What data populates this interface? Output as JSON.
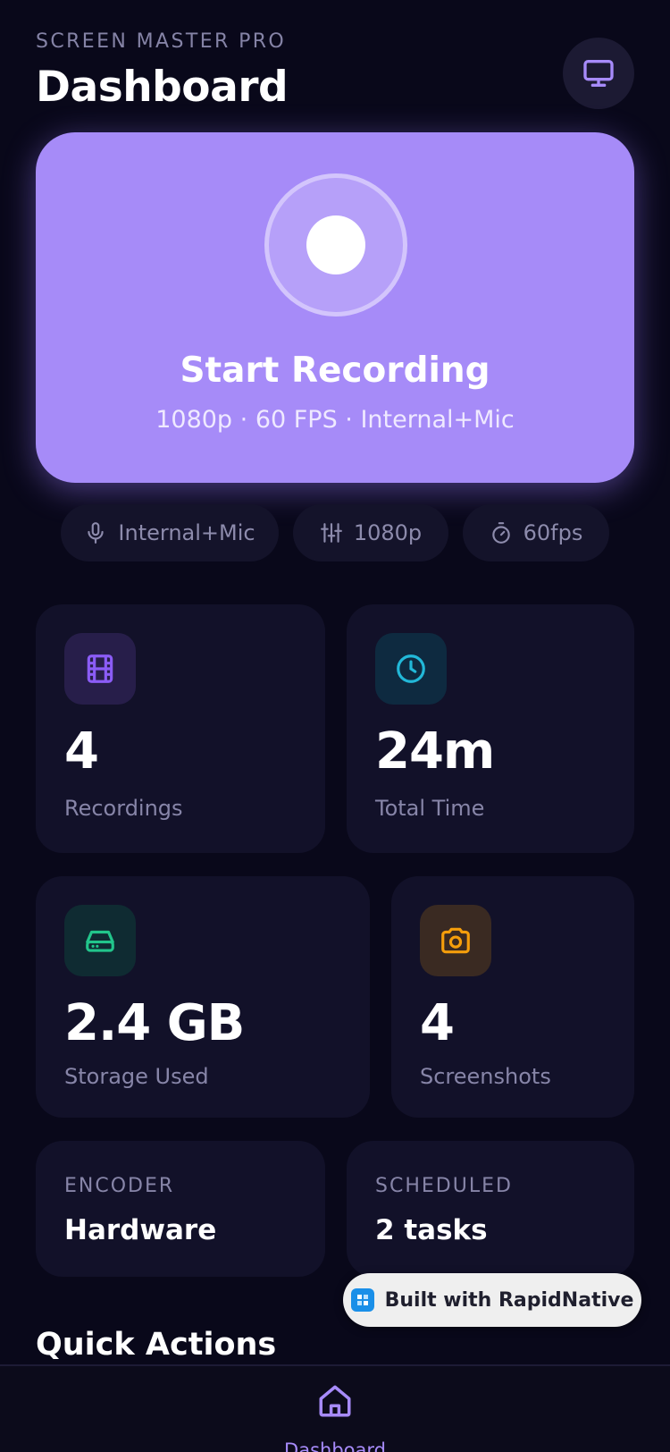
{
  "header": {
    "app_label": "SCREEN MASTER PRO",
    "title": "Dashboard",
    "monitor_icon": "monitor-icon"
  },
  "hero": {
    "title": "Start Recording",
    "subtitle": "1080p · 60 FPS · Internal+Mic",
    "color": "#a68bf8"
  },
  "chips": [
    {
      "icon": "microphone-icon",
      "label": "Internal+Mic"
    },
    {
      "icon": "sliders-icon",
      "label": "1080p"
    },
    {
      "icon": "stopwatch-icon",
      "label": "60fps"
    }
  ],
  "stats": [
    {
      "icon": "film-icon",
      "value": "4",
      "label": "Recordings",
      "accent": "#8b5cf6"
    },
    {
      "icon": "clock-icon",
      "value": "24m",
      "label": "Total Time",
      "accent": "#22b8d8"
    },
    {
      "icon": "hard-drive-icon",
      "value": "2.4 GB",
      "label": "Storage Used",
      "accent": "#22c58b"
    },
    {
      "icon": "camera-icon",
      "value": "4",
      "label": "Screenshots",
      "accent": "#f59e0b"
    }
  ],
  "info_cards": [
    {
      "label": "ENCODER",
      "value": "Hardware"
    },
    {
      "label": "SCHEDULED",
      "value": "2 tasks"
    }
  ],
  "quick_actions": {
    "title": "Quick Actions"
  },
  "built_with": {
    "label": "Built with RapidNative"
  },
  "bottom_nav": {
    "items": [
      {
        "icon": "home-icon",
        "label": "Dashboard",
        "active": true
      }
    ]
  }
}
